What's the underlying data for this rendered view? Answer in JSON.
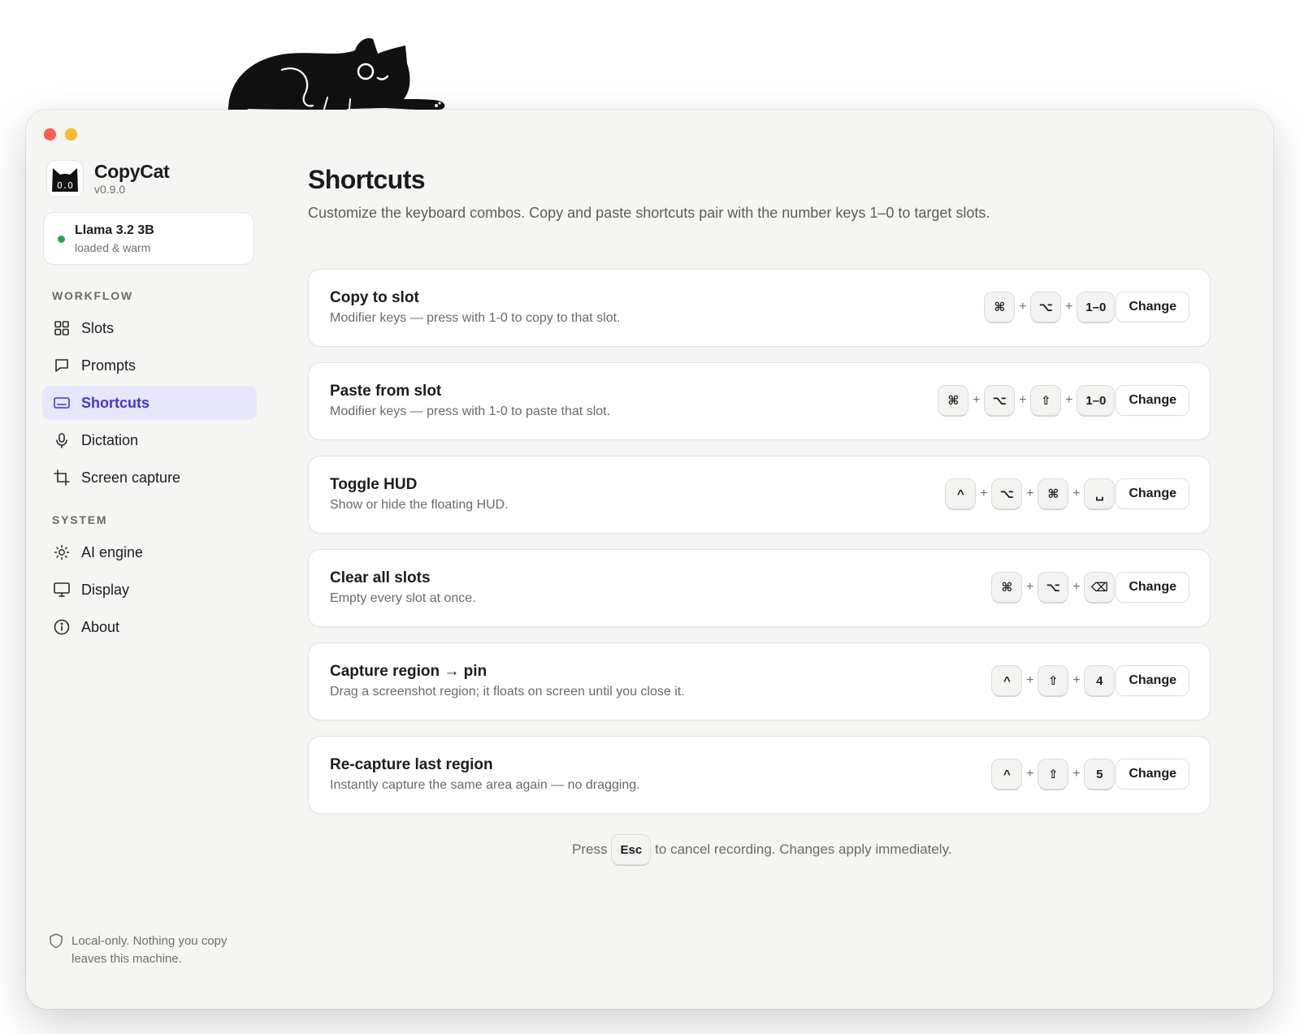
{
  "app": {
    "name": "CopyCat",
    "version": "v0.9.0"
  },
  "model": {
    "name": "Llama 3.2 3B",
    "status": "loaded & warm",
    "status_color": "#30a14e"
  },
  "sidebar": {
    "workflow_label": "WORKFLOW",
    "system_label": "SYSTEM",
    "workflow_items": [
      {
        "label": "Slots",
        "icon": "grid-icon"
      },
      {
        "label": "Prompts",
        "icon": "message-icon"
      },
      {
        "label": "Shortcuts",
        "icon": "keyboard-icon",
        "active": true
      },
      {
        "label": "Dictation",
        "icon": "microphone-icon"
      },
      {
        "label": "Screen capture",
        "icon": "crop-icon"
      }
    ],
    "system_items": [
      {
        "label": "AI engine",
        "icon": "sun-icon"
      },
      {
        "label": "Display",
        "icon": "monitor-icon"
      },
      {
        "label": "About",
        "icon": "info-icon"
      }
    ],
    "footer": "Local-only. Nothing you copy leaves this machine."
  },
  "main": {
    "title": "Shortcuts",
    "description": "Customize the keyboard combos. Copy and paste shortcuts pair with the number keys 1–0 to target slots.",
    "change_label": "Change",
    "shortcuts": [
      {
        "title": "Copy to slot",
        "subtitle": "Modifier keys — press with 1-0 to copy to that slot.",
        "keys": [
          "⌘",
          "⌥",
          "1–0"
        ]
      },
      {
        "title": "Paste from slot",
        "subtitle": "Modifier keys — press with 1-0 to paste that slot.",
        "keys": [
          "⌘",
          "⌥",
          "⇧",
          "1–0"
        ]
      },
      {
        "title": "Toggle HUD",
        "subtitle": "Show or hide the floating HUD.",
        "keys": [
          "^",
          "⌥",
          "⌘",
          "␣"
        ]
      },
      {
        "title": "Clear all slots",
        "subtitle": "Empty every slot at once.",
        "keys": [
          "⌘",
          "⌥",
          "⌫"
        ]
      },
      {
        "title": "Capture region → pin",
        "subtitle": "Drag a screenshot region; it floats on screen until you close it.",
        "keys": [
          "^",
          "⇧",
          "4"
        ]
      },
      {
        "title": "Re-capture last region",
        "subtitle": "Instantly capture the same area again — no dragging.",
        "keys": [
          "^",
          "⇧",
          "5"
        ]
      }
    ],
    "hint": {
      "prefix": "Press",
      "key": "Esc",
      "suffix": "to cancel recording. Changes apply immediately."
    }
  },
  "colors": {
    "accent": "#4634d6",
    "active_bg": "#e8e6fa",
    "close": "#ff5f57",
    "minimize": "#febc2e"
  }
}
